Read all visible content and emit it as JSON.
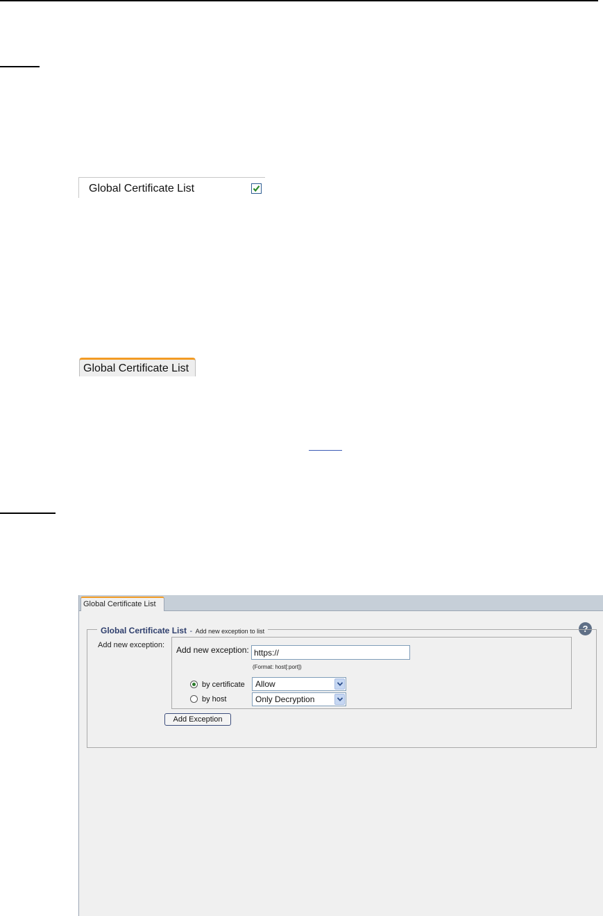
{
  "checkbox_snippet": {
    "label": "Global Certificate List",
    "checked": true
  },
  "tab_snippet": {
    "label": "Global Certificate List"
  },
  "panel": {
    "tab_label": "Global Certificate List",
    "legend_title": "Global Certificate List",
    "legend_separator": "-",
    "legend_subtitle": "Add new exception to list",
    "help_glyph": "?",
    "outer_label": "Add new exception:",
    "inner_label": "Add new exception:",
    "input_value": "https://",
    "format_hint": "(Format: host[:port])",
    "radio_certificate_label": "by certificate",
    "radio_host_label": "by host",
    "select_certificate_value": "Allow",
    "select_host_value": "Only Decryption",
    "add_button_label": "Add Exception"
  },
  "colors": {
    "tab_accent": "#f29b24",
    "legend_text": "#2f3f6d",
    "check_mark": "#2a8a2a"
  }
}
